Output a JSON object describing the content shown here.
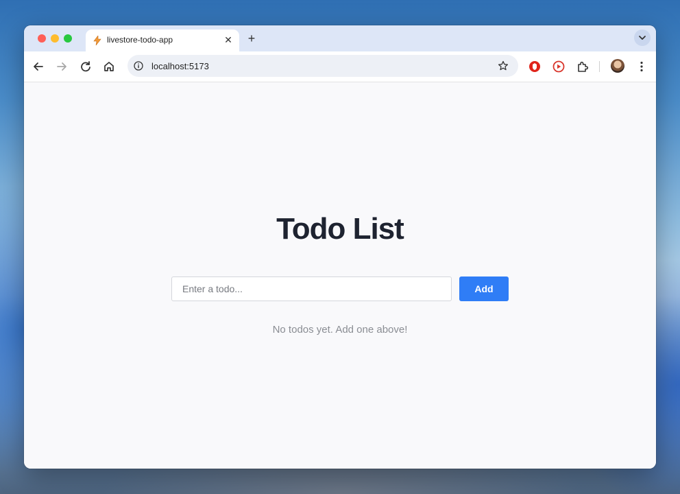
{
  "browser": {
    "tab": {
      "title": "livestore-todo-app",
      "close_glyph": "✕",
      "favicon": "livestore-bolt-icon"
    },
    "new_tab_glyph": "+",
    "address": {
      "url": "localhost:5173"
    },
    "icons": {
      "back": "back-arrow-icon",
      "forward": "forward-arrow-icon",
      "reload": "reload-icon",
      "home": "home-icon",
      "bookmark": "star-icon",
      "extension_1": "red-shield-extension-icon",
      "extension_2": "red-play-extension-icon",
      "extensions": "puzzle-icon",
      "menu": "kebab-menu-icon"
    },
    "accent": "#dde6f7"
  },
  "app": {
    "title": "Todo List",
    "input": {
      "placeholder": "Enter a todo...",
      "value": ""
    },
    "add_label": "Add",
    "empty_message": "No todos yet. Add one above!",
    "colors": {
      "button": "#2f7df6",
      "title": "#1e2330",
      "muted_text": "#8a8d93"
    }
  }
}
